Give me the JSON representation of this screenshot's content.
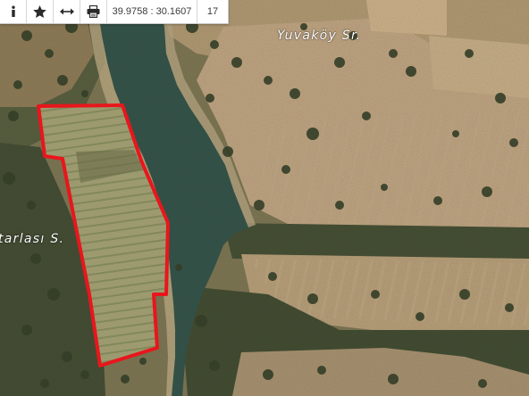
{
  "toolbar": {
    "info_icon": "info-icon",
    "favorite_icon": "star-icon",
    "measure_icon": "measure-arrows-icon",
    "print_icon": "printer-icon",
    "coordinates": "39.9758 : 30.1607",
    "zoom_level": "17"
  },
  "map": {
    "labels": {
      "reservoir": "Yuvaköy Sr.",
      "field_area": "tarlası S."
    },
    "parcel_outline_color": "#e8161c",
    "water_color": "#2d4f48"
  }
}
